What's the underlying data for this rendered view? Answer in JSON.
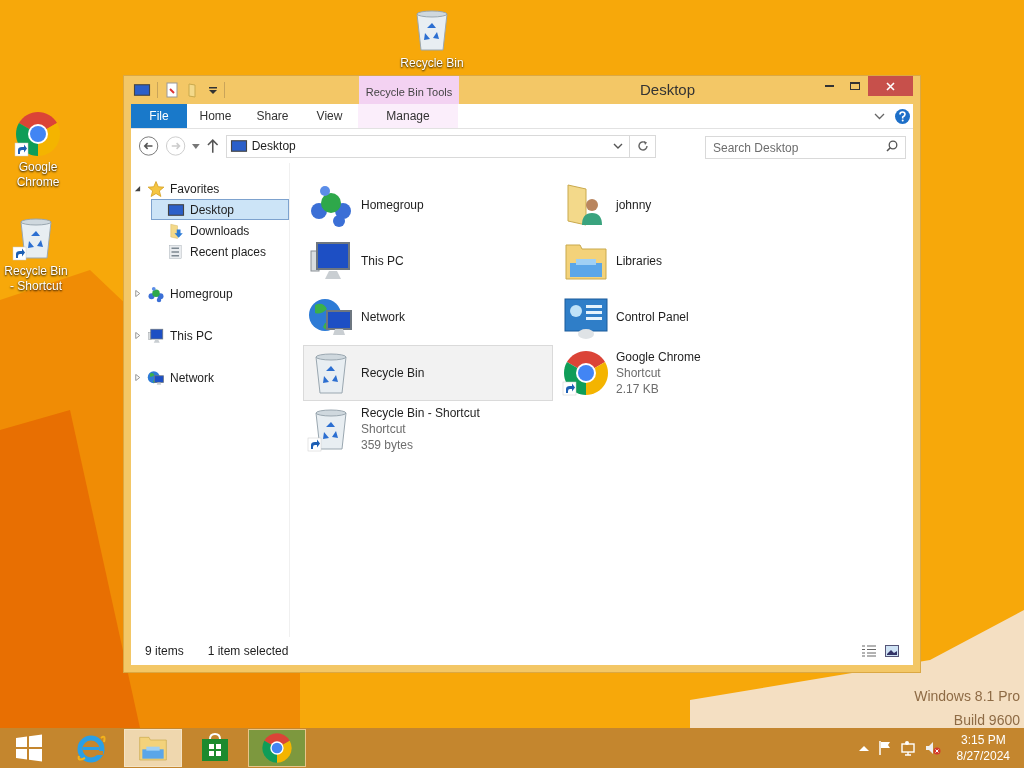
{
  "desktop_icons": [
    {
      "label": "Recycle Bin",
      "kind": "bin",
      "shortcut": false
    },
    {
      "label": "Google Chrome",
      "kind": "chrome",
      "shortcut": true
    },
    {
      "label": "Recycle Bin - Shortcut",
      "kind": "bin",
      "shortcut": true
    }
  ],
  "window": {
    "title": "Desktop",
    "contextual_group": "Recycle Bin Tools",
    "ribbon_tabs": [
      {
        "label": "File",
        "kind": "file",
        "selected": false
      },
      {
        "label": "Home",
        "kind": "tab",
        "selected": false
      },
      {
        "label": "Share",
        "kind": "tab",
        "selected": false
      },
      {
        "label": "View",
        "kind": "tab",
        "selected": false
      },
      {
        "label": "Manage",
        "kind": "contextual",
        "selected": false
      }
    ],
    "address": "Desktop",
    "search": {
      "placeholder": "Search Desktop"
    },
    "nav_tree": [
      {
        "label": "Favorites",
        "kind": "star",
        "expanded": true,
        "selected": false,
        "children": [
          {
            "label": "Desktop",
            "kind": "desktop",
            "selected": true
          },
          {
            "label": "Downloads",
            "kind": "downloads",
            "selected": false
          },
          {
            "label": "Recent places",
            "kind": "recent",
            "selected": false
          }
        ]
      },
      {
        "label": "Homegroup",
        "kind": "homegroup",
        "expanded": false,
        "selected": false
      },
      {
        "label": "This PC",
        "kind": "pc",
        "expanded": false,
        "selected": false
      },
      {
        "label": "Network",
        "kind": "network",
        "expanded": false,
        "selected": false
      }
    ],
    "items": [
      {
        "name": "Homegroup",
        "kind": "homegroup",
        "shortcut": false,
        "selected": false
      },
      {
        "name": "This PC",
        "kind": "pc",
        "shortcut": false,
        "selected": false
      },
      {
        "name": "Network",
        "kind": "network",
        "shortcut": false,
        "selected": false
      },
      {
        "name": "Recycle Bin",
        "kind": "bin",
        "shortcut": false,
        "selected": true
      },
      {
        "name": "Recycle Bin - Shortcut",
        "kind": "bin",
        "details": [
          "Shortcut",
          "359 bytes"
        ],
        "shortcut": true,
        "selected": false
      },
      {
        "name": "johnny",
        "kind": "userfolder",
        "shortcut": false,
        "selected": false
      },
      {
        "name": "Libraries",
        "kind": "libraries",
        "shortcut": false,
        "selected": false
      },
      {
        "name": "Control Panel",
        "kind": "controlpanel",
        "shortcut": false,
        "selected": false
      },
      {
        "name": "Google Chrome",
        "kind": "chrome",
        "details": [
          "Shortcut",
          "2.17 KB"
        ],
        "shortcut": true,
        "selected": false
      }
    ],
    "status_bar": {
      "count": "9 items",
      "selection": "1 item selected"
    }
  },
  "os_version": {
    "edition": "Windows 8.1 Pro",
    "build": "Build 9600"
  },
  "taskbar": {
    "apps": [
      {
        "kind": "start",
        "active": false
      },
      {
        "kind": "ie",
        "active": false
      },
      {
        "kind": "explorer",
        "active": true
      },
      {
        "kind": "store",
        "active": false
      },
      {
        "kind": "chrome",
        "active": true
      }
    ],
    "clock": {
      "time": "3:15 PM",
      "date": "8/27/2024"
    }
  }
}
